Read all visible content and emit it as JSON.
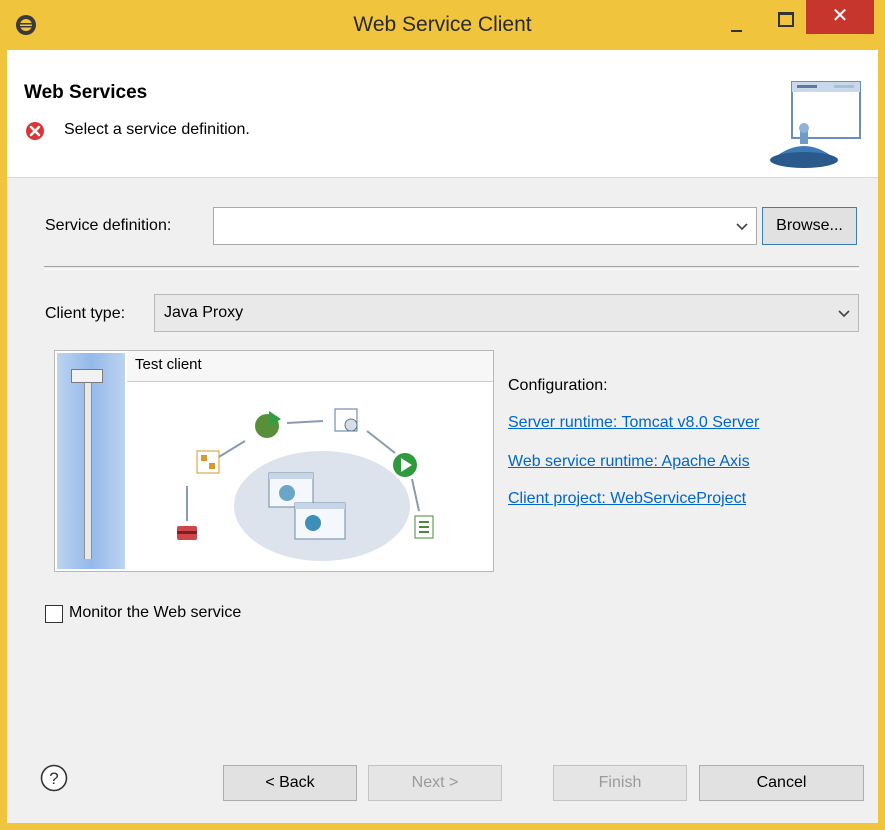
{
  "window": {
    "title": "Web Service Client"
  },
  "header": {
    "title": "Web Services",
    "message": "Select a service definition."
  },
  "service": {
    "label": "Service definition:",
    "value": "",
    "browse_label": "Browse..."
  },
  "client": {
    "label": "Client type:",
    "value": "Java Proxy"
  },
  "slider": {
    "level_label": "Test client"
  },
  "config": {
    "heading": "Configuration:",
    "server_runtime": "Server runtime: Tomcat v8.0 Server",
    "ws_runtime": "Web service runtime: Apache Axis",
    "client_project": "Client project: WebServiceProject"
  },
  "monitor": {
    "label": "Monitor the Web service",
    "checked": false
  },
  "buttons": {
    "back": "< Back",
    "next": "Next >",
    "finish": "Finish",
    "cancel": "Cancel"
  },
  "colors": {
    "titlebar": "#f0c43c",
    "close": "#c7362c",
    "link": "#0066cc",
    "error": "#d9363a"
  }
}
